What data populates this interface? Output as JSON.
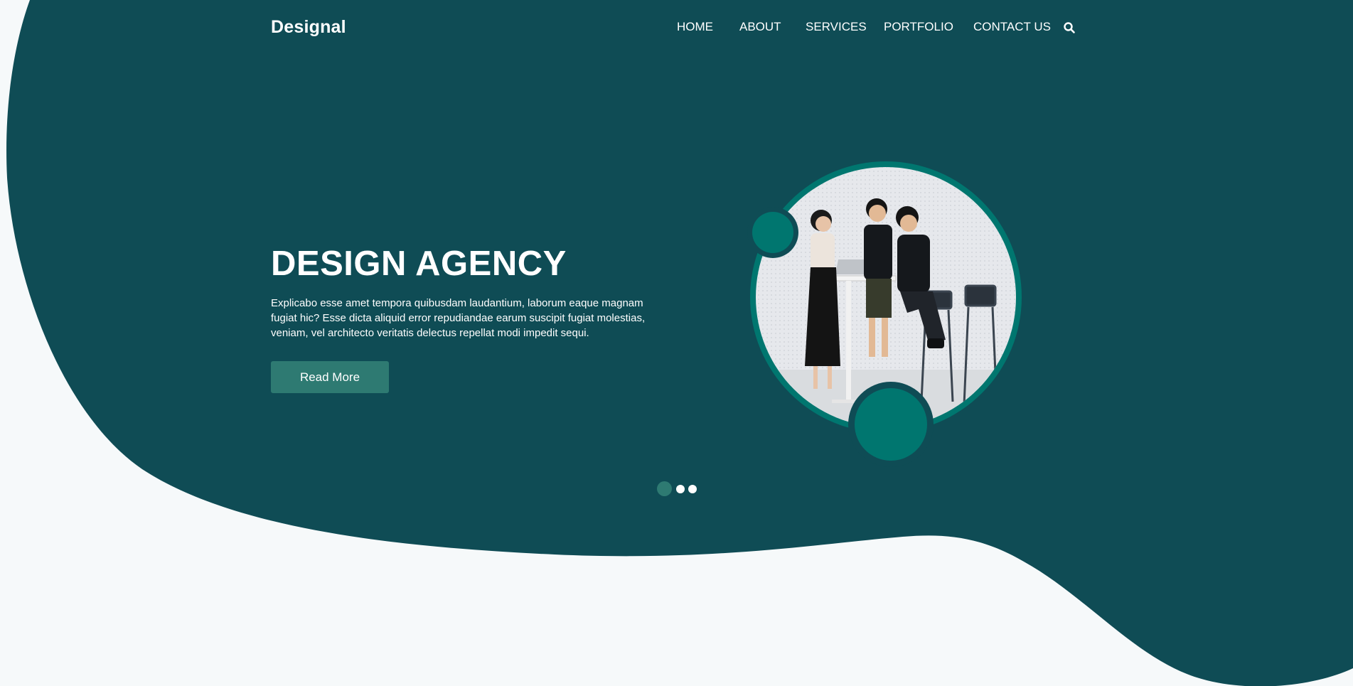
{
  "brand": {
    "name": "Designal"
  },
  "nav": {
    "items": [
      {
        "label": "HOME"
      },
      {
        "label": "ABOUT"
      },
      {
        "label": "SERVICES"
      },
      {
        "label": "PORTFOLIO"
      },
      {
        "label": "CONTACT US"
      }
    ],
    "search_icon": "search-icon"
  },
  "hero": {
    "title": "DESIGN AGENCY",
    "description": "Explicabo esse amet tempora quibusdam laudantium, laborum eaque magnam fugiat hic? Esse dicta aliquid error repudiandae earum suscipit fugiat molestias, veniam, vel architecto veritatis delectus repellat modi impedit sequi.",
    "button_label": "Read More",
    "image": "team-of-three-at-standing-desk-photo"
  },
  "slider": {
    "count": 3,
    "active_index": 1
  },
  "colors": {
    "primary_dark": "#0f4c55",
    "accent": "#00766f",
    "button": "#2e7a72",
    "background": "#f6f9fa"
  }
}
